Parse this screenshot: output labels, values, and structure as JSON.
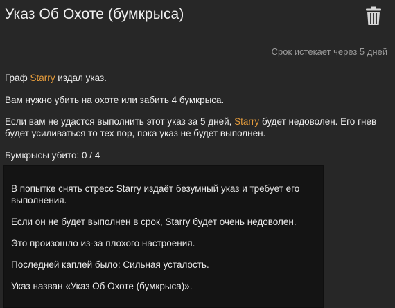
{
  "decree": {
    "title": "Указ Об Охоте (бумкрыса)",
    "expires": "Срок истекает через 5 дней",
    "line1": {
      "pre": "Граф ",
      "name": "Starry",
      "post": " издал указ."
    },
    "line2": "Вам нужно убить на охоте или забить 4 бумкрыса.",
    "line3": {
      "pre": "Если вам не удастся выполнить этот указ за 5 дней, ",
      "name": "Starry",
      "post": " будет недоволен. Его гнев будет усиливаться то тех пор, пока указ не будет выполнен."
    },
    "progress": "Бумкрысы убито: 0 / 4",
    "story": [
      "В попытке снять стресс Starry издаёт безумный указ и требует его выполнения.",
      "Если он не будет выполнен в срок, Starry будет очень недоволен.",
      "Это произошло из-за плохого настроения.",
      "Последней каплей было: Сильная усталость.",
      "Указ назван «Указ Об Охоте (бумкрыса)»."
    ]
  },
  "icons": {
    "delete": "trash-icon"
  },
  "colors": {
    "highlight": "#e59c3c",
    "background": "#272727",
    "story_bg": "#141414"
  }
}
